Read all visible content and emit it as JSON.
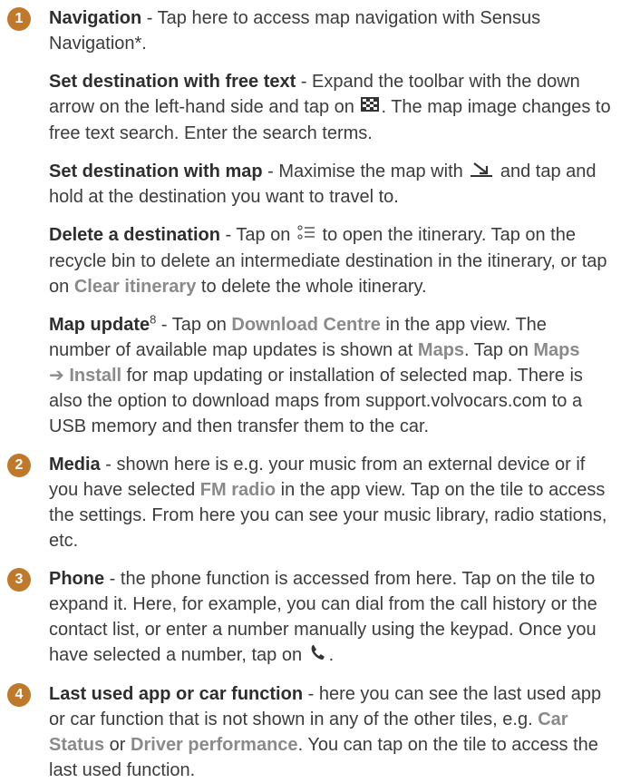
{
  "items": [
    {
      "number": "1",
      "title": "Navigation",
      "text": " - Tap here to access map navigation with Sensus Navigation*."
    },
    {
      "number": "2",
      "title": "Media",
      "text_a": " - shown here is e.g. your music from an external device or if you have selected ",
      "hl": "FM radio",
      "text_b": " in the app view. Tap on the tile to access the settings. From here you can see your music library, radio stations, etc."
    },
    {
      "number": "3",
      "title": "Phone",
      "text_a": " - the phone function is accessed from here. Tap on the tile to expand it. Here, for example, you can dial from the call history or the contact list, or enter a number manually using the keypad. Once you have selected a number, tap on ",
      "text_b": "."
    },
    {
      "number": "4",
      "title": "Last used app or car function",
      "text_a": " - here you can see the last used app or car function that is not shown in any of the other tiles, e.g. ",
      "hl1": "Car Status",
      "text_b": " or ",
      "hl2": "Driver performance",
      "text_c": ". You can tap on the tile to access the last used function."
    }
  ],
  "subs": {
    "free_text": {
      "title": "Set destination with free text",
      "text_a": " - Expand the toolbar with the down arrow on the left-hand side and tap on ",
      "text_b": ". The map image changes to free text search. Enter the search terms."
    },
    "with_map": {
      "title": "Set destination with map",
      "text_a": " - Maximise the map with ",
      "text_b": " and tap and hold at the destination you want to travel to."
    },
    "delete": {
      "title": "Delete a destination",
      "text_a": " - Tap on ",
      "text_b": " to open the itinerary. Tap on the recycle bin to delete an intermediate destination in the itinerary, or tap on ",
      "hl": "Clear itinerary",
      "text_c": " to delete the whole itinerary."
    },
    "map_update": {
      "title": "Map update",
      "sup": "8",
      "text_a": " - Tap on ",
      "hl1": "Download Centre",
      "text_b": " in the app view. The number of available map updates is shown at ",
      "hl2": "Maps",
      "text_c": ". Tap on ",
      "hl3": "Maps",
      "arrow": "➔ Install",
      "text_d": " for map updating or installation of selected map. There is also the option to download maps from support.volvocars.com to a USB memory and then transfer them to the car."
    }
  },
  "colors": {
    "badge": "#c0792b",
    "highlight": "#8a8a8a",
    "text": "#3c3c3c"
  },
  "icons": [
    "checkered-flag-icon",
    "maximise-arrow-icon",
    "itinerary-list-icon",
    "phone-handset-icon"
  ]
}
